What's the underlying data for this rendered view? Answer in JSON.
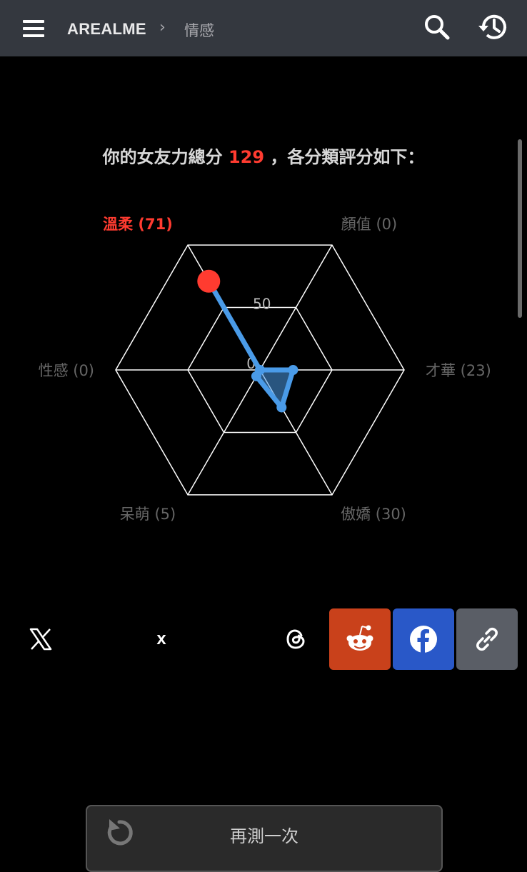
{
  "header": {
    "brand": "AREALME",
    "separator": "›",
    "breadcrumb": "情感",
    "icons": [
      "menu-icon",
      "search-icon",
      "history-icon"
    ]
  },
  "result": {
    "prefix": "你的女友力總分 ",
    "total": "129",
    "suffix": " ，各分類評分如下："
  },
  "chart_data": {
    "type": "radar",
    "max": 100,
    "rings": [
      0,
      50,
      100
    ],
    "ring_labels": [
      "0",
      "50"
    ],
    "highlight_color": "#ff3b30",
    "series_color": "#4a9be8",
    "axes": [
      {
        "label": "顏值 (0)",
        "value": 0
      },
      {
        "label": "才華 (23)",
        "value": 23
      },
      {
        "label": "傲嬌 (30)",
        "value": 30
      },
      {
        "label": "呆萌 (5)",
        "value": 5
      },
      {
        "label": "性感 (0)",
        "value": 0
      },
      {
        "label": "溫柔 (71)",
        "value": 71,
        "highlight": true
      }
    ]
  },
  "share": {
    "items": [
      {
        "name": "x-icon"
      },
      {
        "label": "x"
      },
      {
        "name": "threads-icon"
      },
      {
        "name": "reddit-icon",
        "color": "#c9411b"
      },
      {
        "name": "facebook-icon",
        "color": "#2958c8"
      },
      {
        "name": "link-icon",
        "color": "#5a5e66"
      }
    ]
  },
  "retry": {
    "label": "再測一次",
    "icon": "refresh-icon"
  }
}
